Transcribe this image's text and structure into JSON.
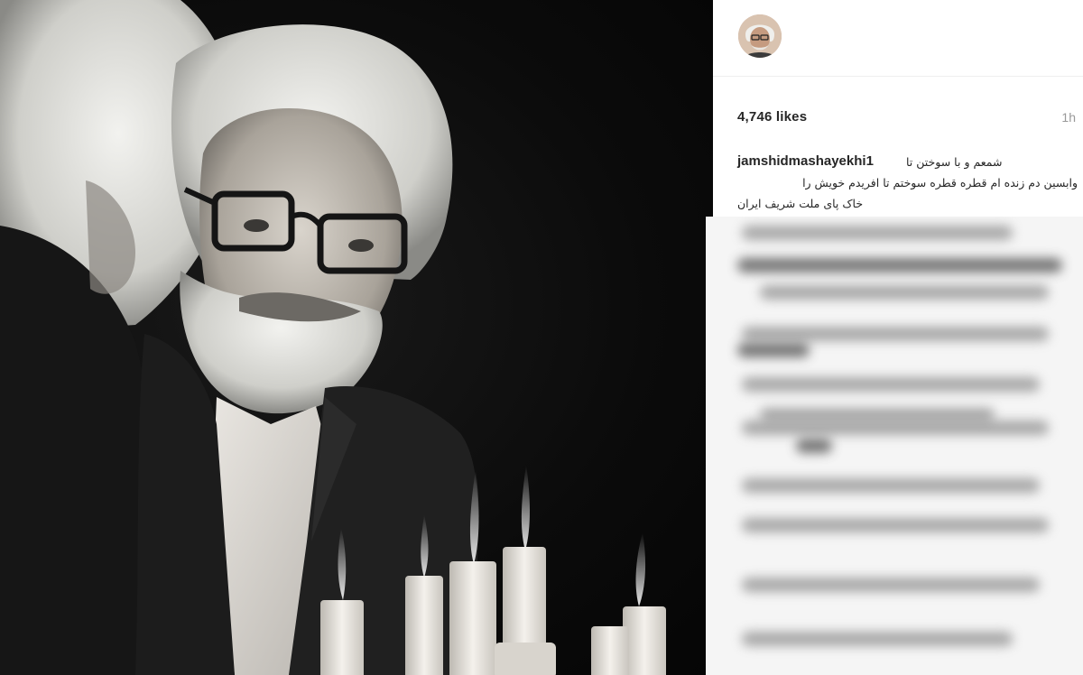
{
  "post": {
    "likes": "4,746 likes",
    "time": "1h",
    "username": "jamshidmashayekhi1",
    "caption_line1": "شمعم و با سوختن تا",
    "caption_line2": "وابسین دم زنده ام قطره قطره سوختم تا افریدم خویش را",
    "caption_line3": "خاک پای ملت شریف ایران"
  },
  "colors": {
    "text": "#262626",
    "muted": "#999999",
    "divider": "#efefef"
  },
  "icons": {
    "avatar": "profile-photo"
  }
}
